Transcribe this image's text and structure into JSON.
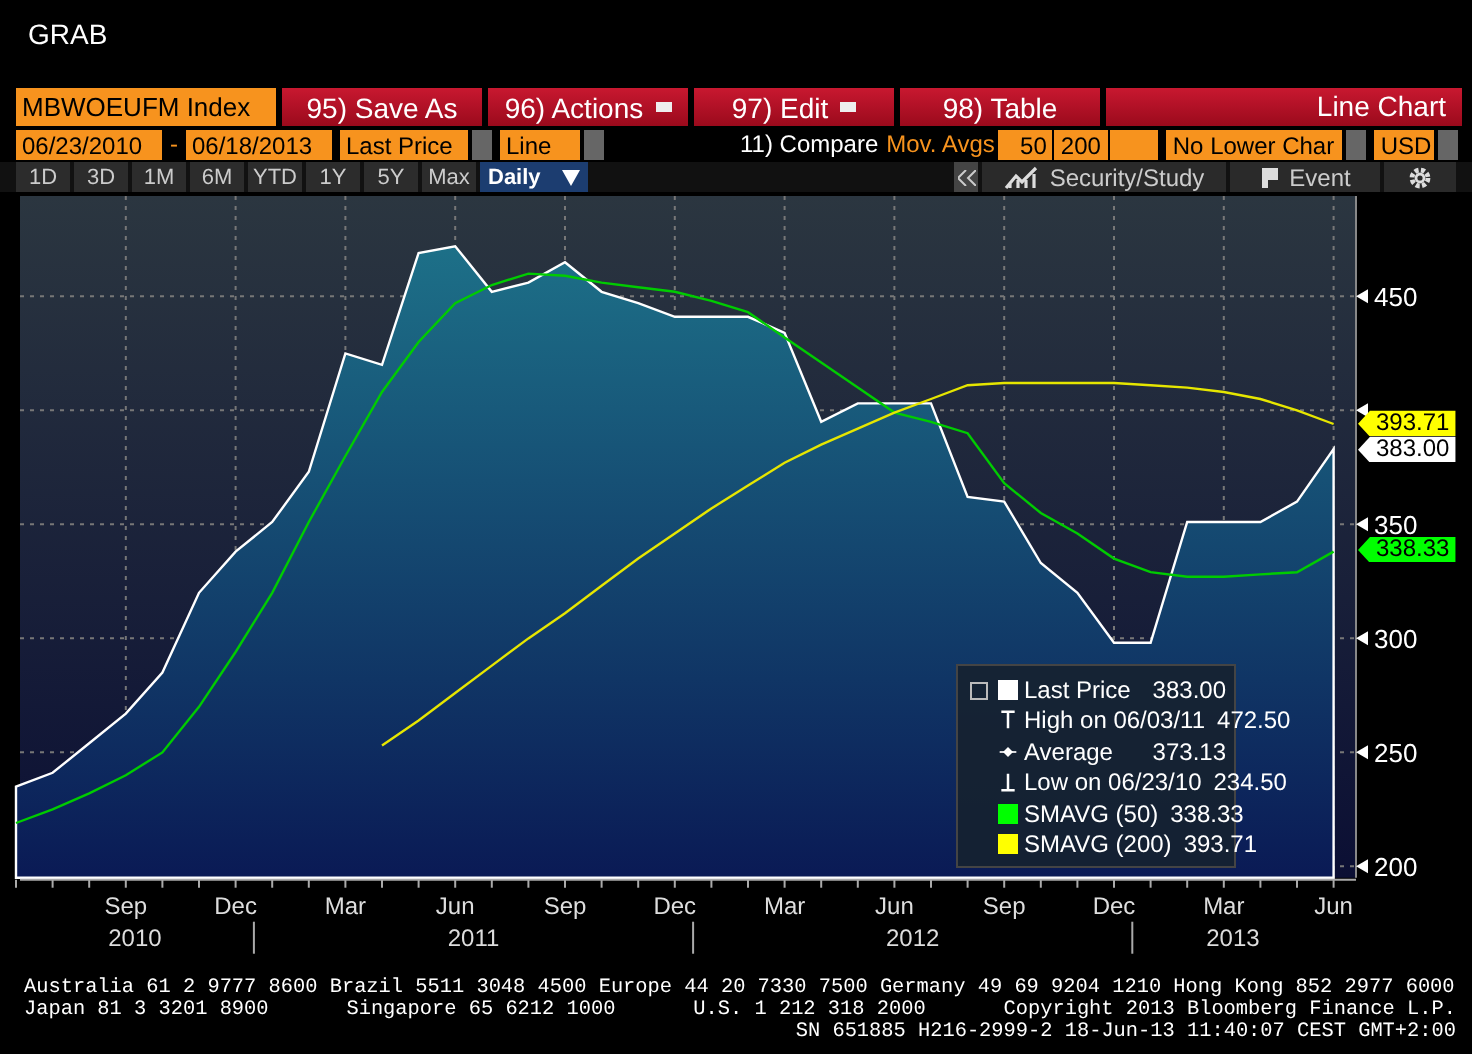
{
  "title": "GRAB",
  "security": "MBWOEUFM Index",
  "menu": [
    {
      "label": "95) Save As",
      "dropdown": false
    },
    {
      "label": "96) Actions",
      "dropdown": true
    },
    {
      "label": "97) Edit",
      "dropdown": true
    },
    {
      "label": "98) Table",
      "dropdown": false
    }
  ],
  "view_title": "Line Chart",
  "start_date": "06/23/2010",
  "date_separator": "-",
  "end_date": "06/18/2013",
  "price_field": "Last Price",
  "chart_style": "Line",
  "compare_label": "11) Compare",
  "mov_avgs_label": "Mov. Avgs",
  "mov_avg_1": "50",
  "mov_avg_2": "200",
  "lower_chart": "No Lower Char",
  "currency": "USD",
  "periods": [
    {
      "label": "1D",
      "selected": false
    },
    {
      "label": "3D",
      "selected": false
    },
    {
      "label": "1M",
      "selected": false
    },
    {
      "label": "6M",
      "selected": false
    },
    {
      "label": "YTD",
      "selected": false
    },
    {
      "label": "1Y",
      "selected": false
    },
    {
      "label": "5Y",
      "selected": false
    },
    {
      "label": "Max",
      "selected": false
    }
  ],
  "frequency": "Daily",
  "toolbar": [
    {
      "label": "Security/Study",
      "kind": "study"
    },
    {
      "label": "Event",
      "kind": "event"
    }
  ],
  "chart": {
    "chart_data": {
      "type": "line",
      "categories": [
        null,
        null,
        null,
        "Sep",
        null,
        null,
        "Dec",
        null,
        null,
        "Mar",
        null,
        null,
        "Jun",
        null,
        null,
        "Sep",
        null,
        null,
        "Dec",
        null,
        null,
        "Mar",
        null,
        null,
        "Jun",
        null,
        null,
        "Sep",
        null,
        null,
        "Dec",
        null,
        null,
        "Mar",
        null,
        null,
        "Jun"
      ],
      "ylim": [
        195,
        494
      ],
      "grid": true,
      "yticks": [
        200,
        250,
        300,
        350,
        450
      ],
      "series": [
        {
          "name": "Last Price",
          "type": "area",
          "color": "#ffffff",
          "values": [
            235,
            241,
            254,
            267,
            285,
            320,
            338,
            351,
            373,
            425,
            420,
            469,
            472,
            452,
            456,
            465,
            452,
            447,
            441,
            441,
            441,
            434,
            395,
            403,
            403,
            403,
            362,
            360,
            333,
            320,
            298,
            298,
            351,
            351,
            351,
            360,
            383
          ]
        },
        {
          "name": "SMAVG (50)",
          "color": "#00cc00",
          "values": [
            219,
            225,
            232,
            240,
            250,
            270,
            294,
            320,
            351,
            380,
            408,
            430,
            447,
            455,
            460,
            459,
            456,
            454,
            452,
            448,
            443,
            432,
            421,
            410,
            399,
            395,
            390,
            368,
            355,
            346,
            335,
            329,
            327,
            327,
            328,
            329,
            338
          ]
        },
        {
          "name": "SMAVG (200)",
          "color": "#e6e600",
          "values": [
            null,
            null,
            null,
            null,
            null,
            null,
            null,
            null,
            null,
            null,
            253,
            264,
            276,
            288,
            300,
            311,
            323,
            335,
            346,
            357,
            367,
            377,
            385,
            392,
            399,
            405,
            411,
            412,
            412,
            412,
            412,
            411,
            410,
            408,
            405,
            400,
            394
          ]
        }
      ]
    },
    "years": [
      "2010",
      "2011",
      "2012",
      "2013"
    ],
    "tags": [
      {
        "text": "393.71",
        "color": "#ffff00"
      },
      {
        "text": "383.00",
        "color": "#ffffff"
      },
      {
        "text": "338.33",
        "color": "#00ff00"
      }
    ],
    "legend": [
      {
        "value": "383.00",
        "kind": "series",
        "color": "#ffffff"
      },
      {
        "label": "High on 06/03/11",
        "value": "472.50",
        "kind": "high"
      },
      {
        "label": "Average",
        "value": "373.13",
        "kind": "average"
      },
      {
        "label": "Low on 06/23/10",
        "value": "234.50",
        "kind": "low"
      },
      {
        "value": "338.33",
        "kind": "series",
        "color": "#00ff00"
      },
      {
        "value": "393.71",
        "kind": "series",
        "color": "#ffff00"
      }
    ]
  },
  "footer": [
    [
      "Australia 61 2 9777 8600 Brazil 5511 3048 4500 Europe 44 20 7330 7500 Germany 49 69 9204 1210 Hong Kong 852 2977 6000"
    ],
    [
      "Japan 81 3 3201 8900",
      "Singapore 65 6212 1000",
      "U.S. 1 212 318 2000",
      "Copyright 2013 Bloomberg Finance L.P."
    ],
    [
      "SN 651885 H216-2999-2 18-Jun-13 11:40:07 CEST GMT+2:00"
    ]
  ]
}
